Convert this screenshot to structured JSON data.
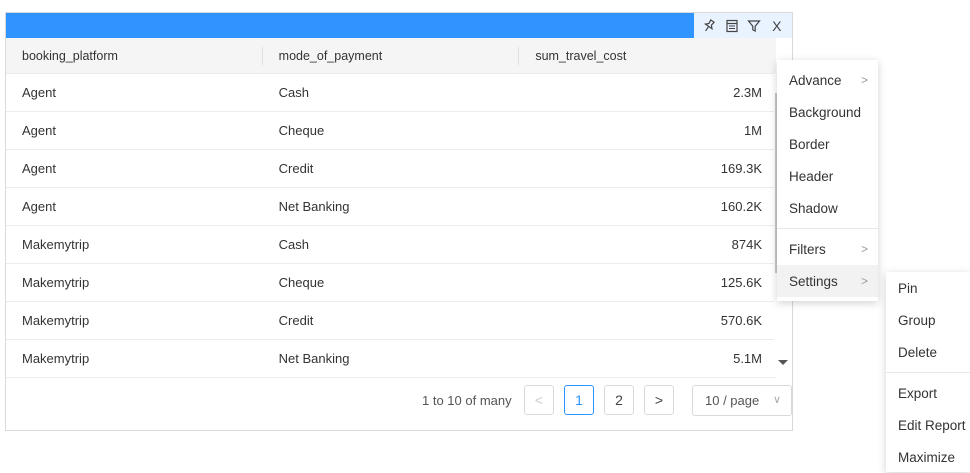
{
  "toolbar": {
    "icons": [
      "pin-icon",
      "columns-icon",
      "filter-icon",
      "close-icon"
    ],
    "close_label": "X"
  },
  "table": {
    "columns": [
      "booking_platform",
      "mode_of_payment",
      "sum_travel_cost"
    ],
    "rows": [
      [
        "Agent",
        "Cash",
        "2.3M"
      ],
      [
        "Agent",
        "Cheque",
        "1M"
      ],
      [
        "Agent",
        "Credit",
        "169.3K"
      ],
      [
        "Agent",
        "Net Banking",
        "160.2K"
      ],
      [
        "Makemytrip",
        "Cash",
        "874K"
      ],
      [
        "Makemytrip",
        "Cheque",
        "125.6K"
      ],
      [
        "Makemytrip",
        "Credit",
        "570.6K"
      ],
      [
        "Makemytrip",
        "Net Banking",
        "5.1M"
      ]
    ]
  },
  "pagination": {
    "info": "1 to 10 of many",
    "prev": "<",
    "pages": [
      "1",
      "2"
    ],
    "next": ">",
    "page_size": "10 / page"
  },
  "context_menu": {
    "items": [
      "Advance",
      "Background",
      "Border",
      "Header",
      "Shadow",
      "Filters",
      "Settings"
    ],
    "chevron": ">"
  },
  "settings_submenu": {
    "items": [
      "Pin",
      "Group",
      "Delete",
      "Export",
      "Edit Report",
      "Maximize"
    ]
  },
  "colors": {
    "header_bar": "#2f94ff",
    "accent": "#2f94ff"
  }
}
